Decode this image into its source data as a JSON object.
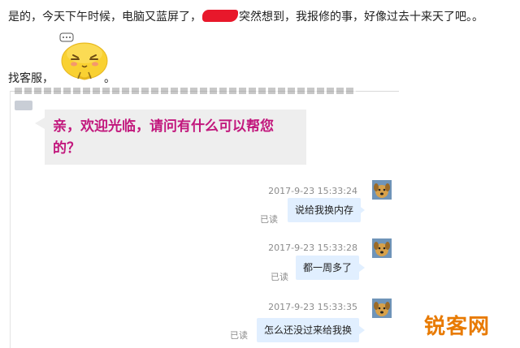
{
  "post": {
    "line1_part1": "是的，今天下午时候，电脑又蓝屏了，",
    "line1_part2": "突然想到，我报修的事，好像过去十来天了吧。。",
    "line2_part1": "找客服，",
    "line2_part2": "。"
  },
  "chat": {
    "agent_message_line1": "亲，欢迎光临，请问有什么可以帮您",
    "agent_message_line2": "的？",
    "messages": [
      {
        "timestamp": "2017-9-23 15:33:24",
        "text": "说给我换内存",
        "status": "已读"
      },
      {
        "timestamp": "2017-9-23 15:33:28",
        "text": "都一周多了",
        "status": "已读"
      },
      {
        "timestamp": "2017-9-23 15:33:35",
        "text": "怎么还没过来给我换",
        "status": "已读"
      }
    ]
  },
  "watermark": {
    "text": "锐客网"
  },
  "icons": {
    "sticker": "yellow-blob-emoji-icon",
    "agent_avatar": "agent-avatar-icon",
    "user_avatar": "dog-avatar-icon"
  },
  "colors": {
    "agent_text": "#c2187d",
    "agent_bubble": "#eeeeee",
    "user_bubble": "#e1efff",
    "meta_text": "#8c8c8c",
    "watermark": "#e87a00",
    "redaction": "#e8182b"
  }
}
